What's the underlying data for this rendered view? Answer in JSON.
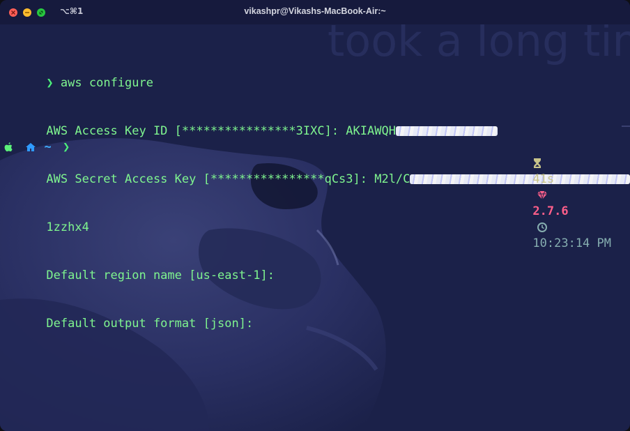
{
  "window": {
    "title": "vikashpr@Vikashs-MacBook-Air:~",
    "shortcut": "⌥⌘1"
  },
  "terminal": {
    "prompt_symbol": "❯",
    "lines": [
      {
        "text": "aws configure"
      },
      {
        "text": "AWS Access Key ID [****************3IXC]: AKIAWQH"
      },
      {
        "text": "AWS Secret Access Key [****************qCs3]: M2l/C"
      },
      {
        "text": "1zzhx4"
      },
      {
        "text": "Default region name [us-east-1]:"
      },
      {
        "text": "Default output format [json]:"
      }
    ]
  },
  "prompt_bar": {
    "home_dir": "~",
    "arrow": "❯",
    "duration": "41s",
    "ruby_version": "2.7.6",
    "time": "10:23:14 PM"
  },
  "icons": [
    "close-icon",
    "minimize-icon",
    "maximize-icon",
    "apple-icon",
    "home-icon",
    "hourglass-icon",
    "ruby-gem-icon",
    "clock-icon"
  ]
}
